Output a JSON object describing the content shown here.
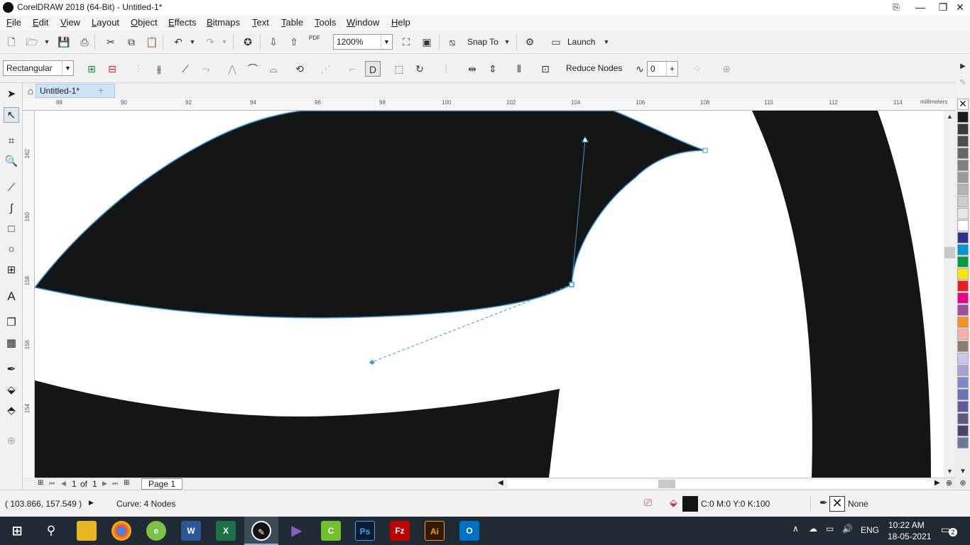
{
  "window": {
    "title": "CorelDRAW 2018 (64-Bit) - Untitled-1*",
    "minimize": "—",
    "restore": "❐",
    "close": "✕"
  },
  "menus": [
    "File",
    "Edit",
    "View",
    "Layout",
    "Object",
    "Effects",
    "Bitmaps",
    "Text",
    "Table",
    "Tools",
    "Window",
    "Help"
  ],
  "standard_toolbar": {
    "zoom_value": "1200%",
    "snap_label": "Snap To",
    "launch_label": "Launch",
    "pdf_label": "PDF"
  },
  "property_bar": {
    "selection_mode": "Rectangular",
    "reduce_nodes_label": "Reduce Nodes",
    "curve_smoothness_value": "0"
  },
  "document_tab": {
    "label": "Untitled-1*",
    "add": "+"
  },
  "ruler": {
    "h_labels": [
      "88",
      "90",
      "92",
      "94",
      "96",
      "98",
      "100",
      "102",
      "104",
      "106",
      "108",
      "110",
      "112",
      "114"
    ],
    "units": "millimeters",
    "v_labels": [
      "162",
      "160",
      "158",
      "156",
      "154"
    ]
  },
  "page_nav": {
    "current": "1",
    "of_label": "of",
    "total": "1",
    "page_tab": "Page 1"
  },
  "status": {
    "cursor_coords": "( 103.866, 157.549 )",
    "selection_info": "Curve: 4 Nodes",
    "fill_info": "C:0 M:0 Y:0 K:100",
    "outline_info": "None"
  },
  "palette_colors": [
    "#1a1a1a",
    "#3a3a3a",
    "#4d4d4d",
    "#666666",
    "#808080",
    "#999999",
    "#b3b3b3",
    "#cccccc",
    "#e6e6e6",
    "#ffffff",
    "#2e3192",
    "#0096d6",
    "#009a44",
    "#ffe600",
    "#ed1c24",
    "#ec008c",
    "#a14d9b",
    "#f7941d",
    "#f9b0a8",
    "#8c7b70",
    "#c8c8e8",
    "#a9a0d6",
    "#7b8bc4",
    "#6a75b8",
    "#5c5aa0",
    "#5e5a82",
    "#4a4566",
    "#6b7a9a"
  ],
  "taskbar": {
    "time": "10:22 AM",
    "date": "18-05-2021",
    "lang": "ENG",
    "notifications": "2"
  },
  "icons": {
    "app": "coreldraw-icon",
    "palette_none": "no-color-icon"
  }
}
